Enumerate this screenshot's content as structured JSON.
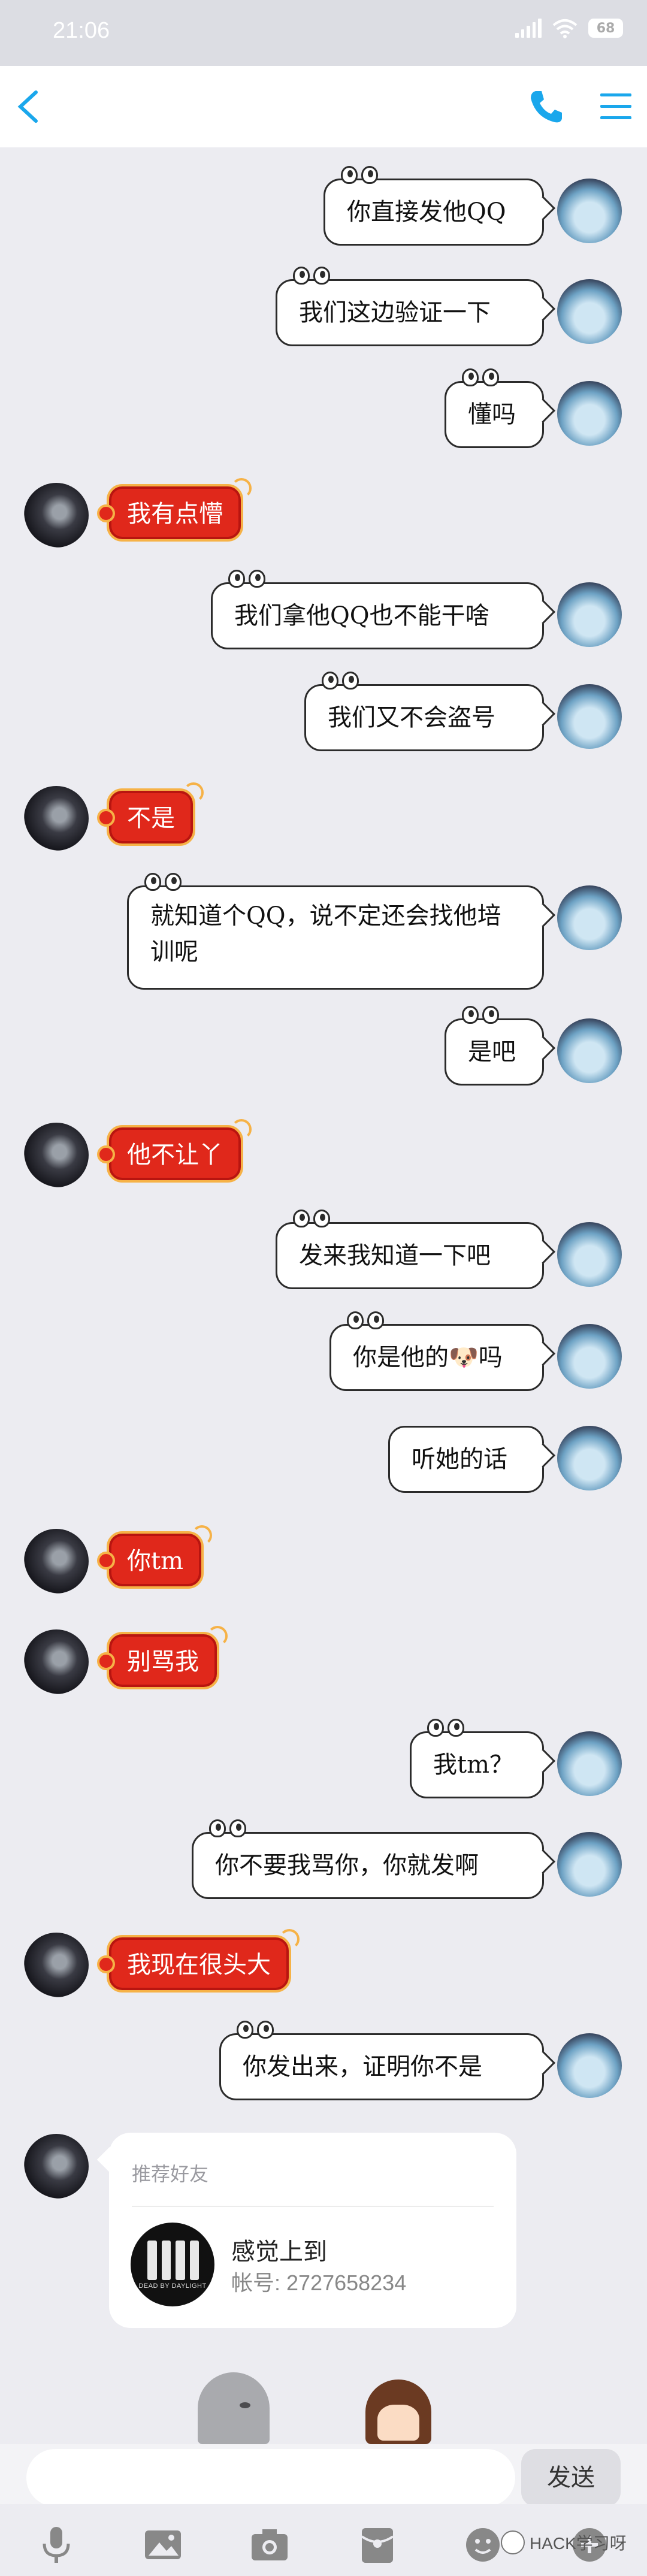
{
  "status_bar": {
    "time": "21:06",
    "battery": "68"
  },
  "nav": {
    "back_icon": "back-chevron-icon",
    "call_icon": "phone-icon",
    "menu_icon": "menu-icon",
    "accent_color": "#1aa7ec"
  },
  "messages": [
    {
      "side": "me",
      "text": "你直接发他QQ"
    },
    {
      "side": "me",
      "text": "我们这边验证一下"
    },
    {
      "side": "me",
      "text": "懂吗"
    },
    {
      "side": "other",
      "text": "我有点懵"
    },
    {
      "side": "me",
      "text": "我们拿他QQ也不能干啥"
    },
    {
      "side": "me",
      "text": "我们又不会盗号"
    },
    {
      "side": "other",
      "text": "不是"
    },
    {
      "side": "me",
      "text": "就知道个QQ，说不定还会找他培训呢"
    },
    {
      "side": "me",
      "text": "是吧"
    },
    {
      "side": "other",
      "text": "他不让丫"
    },
    {
      "side": "me",
      "text": "发来我知道一下吧"
    },
    {
      "side": "me",
      "text": "你是他的🐶吗"
    },
    {
      "side": "me",
      "text": "听她的话"
    },
    {
      "side": "other",
      "text": "你tm"
    },
    {
      "side": "other",
      "text": "别骂我"
    },
    {
      "side": "me",
      "text": "我tm？"
    },
    {
      "side": "me",
      "text": "你不要我骂你，你就发啊"
    },
    {
      "side": "other",
      "text": "我现在很头大"
    },
    {
      "side": "me",
      "text": "你发出来，证明你不是"
    }
  ],
  "contact_card": {
    "title": "推荐好友",
    "name": "感觉上到",
    "account": "帐号: 2727658234",
    "logo_caption": "DEAD BY DAYLIGHT"
  },
  "input": {
    "placeholder": "",
    "send_label": "发送"
  },
  "toolbar": {
    "icons": [
      "mic-icon",
      "image-icon",
      "camera-icon",
      "red-packet-icon",
      "emoji-icon",
      "more-icon"
    ]
  },
  "watermark": "HACK学习呀"
}
